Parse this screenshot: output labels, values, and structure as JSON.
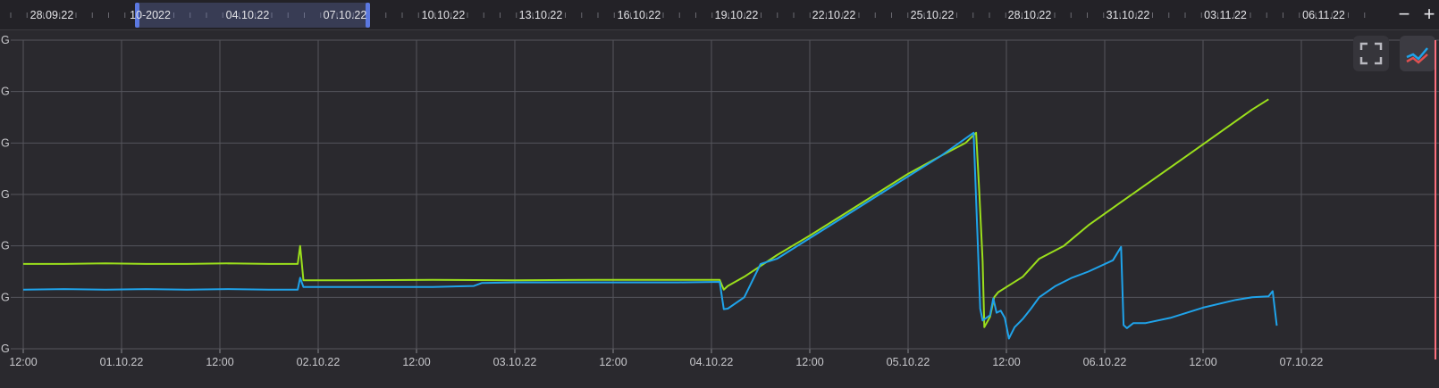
{
  "navigator": {
    "labels": [
      "28.09.22",
      "10-2022",
      "04.10.22",
      "07.10.22",
      "10.10.22",
      "13.10.22",
      "16.10.22",
      "19.10.22",
      "22.10.22",
      "25.10.22",
      "28.10.22",
      "31.10.22",
      "03.11.22",
      "06.11.22"
    ],
    "zoom_out": "−",
    "zoom_in": "+"
  },
  "colors": {
    "background": "#2a292e",
    "grid": "#55555c",
    "series_green": "#9bdf1c",
    "series_blue": "#1fa3ea",
    "marker": "#ff6f7d",
    "selection": "#5b78e0"
  },
  "icons": {
    "fullscreen": "fullscreen-icon",
    "series_toggle": "line-chart-icon"
  },
  "chart_data": {
    "type": "line",
    "x_axis": {
      "tick_labels": [
        "12:00",
        "01.10.22",
        "12:00",
        "02.10.22",
        "12:00",
        "03.10.22",
        "12:00",
        "04.10.22",
        "12:00",
        "05.10.22",
        "12:00",
        "06.10.22",
        "12:00",
        "07.10.22"
      ],
      "range_hours": [
        0,
        168
      ]
    },
    "y_axis": {
      "tick_labels": [
        "G",
        "G",
        "G",
        "G",
        "G",
        "G",
        "G"
      ],
      "range": [
        0,
        6
      ]
    },
    "grid": true,
    "series": [
      {
        "color": "#9bdf1c",
        "points": [
          [
            0,
            1.65
          ],
          [
            5,
            1.65
          ],
          [
            10,
            1.66
          ],
          [
            15,
            1.65
          ],
          [
            20,
            1.65
          ],
          [
            25,
            1.66
          ],
          [
            30,
            1.65
          ],
          [
            33.5,
            1.65
          ],
          [
            33.8,
            2.0
          ],
          [
            34.2,
            1.33
          ],
          [
            40,
            1.33
          ],
          [
            50,
            1.34
          ],
          [
            60,
            1.33
          ],
          [
            70,
            1.34
          ],
          [
            80,
            1.34
          ],
          [
            85,
            1.34
          ],
          [
            85.5,
            1.15
          ],
          [
            86,
            1.22
          ],
          [
            88,
            1.4
          ],
          [
            92,
            1.82
          ],
          [
            96,
            2.2
          ],
          [
            100,
            2.6
          ],
          [
            104,
            3.0
          ],
          [
            108,
            3.4
          ],
          [
            112,
            3.75
          ],
          [
            115,
            4.0
          ],
          [
            116.3,
            4.2
          ],
          [
            116.7,
            3.0
          ],
          [
            117.1,
            1.7
          ],
          [
            117.3,
            0.42
          ],
          [
            118,
            0.62
          ],
          [
            118.5,
            1.0
          ],
          [
            119,
            1.1
          ],
          [
            120,
            1.2
          ],
          [
            122,
            1.4
          ],
          [
            124,
            1.75
          ],
          [
            127,
            2.0
          ],
          [
            130,
            2.4
          ],
          [
            134,
            2.85
          ],
          [
            138,
            3.3
          ],
          [
            142,
            3.75
          ],
          [
            146,
            4.2
          ],
          [
            150,
            4.65
          ],
          [
            152,
            4.85
          ]
        ]
      },
      {
        "color": "#1fa3ea",
        "points": [
          [
            0,
            1.15
          ],
          [
            5,
            1.16
          ],
          [
            10,
            1.15
          ],
          [
            15,
            1.16
          ],
          [
            20,
            1.15
          ],
          [
            25,
            1.16
          ],
          [
            30,
            1.15
          ],
          [
            33.5,
            1.15
          ],
          [
            33.8,
            1.38
          ],
          [
            34.2,
            1.2
          ],
          [
            40,
            1.2
          ],
          [
            50,
            1.2
          ],
          [
            55,
            1.22
          ],
          [
            56,
            1.28
          ],
          [
            60,
            1.29
          ],
          [
            70,
            1.29
          ],
          [
            80,
            1.29
          ],
          [
            85,
            1.3
          ],
          [
            85.5,
            0.77
          ],
          [
            86,
            0.78
          ],
          [
            88,
            1.0
          ],
          [
            90,
            1.65
          ],
          [
            92,
            1.75
          ],
          [
            96,
            2.15
          ],
          [
            100,
            2.55
          ],
          [
            104,
            2.95
          ],
          [
            108,
            3.35
          ],
          [
            112,
            3.75
          ],
          [
            116,
            4.2
          ],
          [
            116.8,
            0.78
          ],
          [
            117.1,
            0.55
          ],
          [
            118,
            0.65
          ],
          [
            118.4,
            0.98
          ],
          [
            118.8,
            0.7
          ],
          [
            119.3,
            0.74
          ],
          [
            119.8,
            0.6
          ],
          [
            120.3,
            0.2
          ],
          [
            121,
            0.42
          ],
          [
            122,
            0.58
          ],
          [
            123,
            0.78
          ],
          [
            124,
            1.0
          ],
          [
            126,
            1.22
          ],
          [
            128,
            1.38
          ],
          [
            130,
            1.5
          ],
          [
            133,
            1.72
          ],
          [
            134,
            1.98
          ],
          [
            134.3,
            0.46
          ],
          [
            134.7,
            0.4
          ],
          [
            135.5,
            0.5
          ],
          [
            137,
            0.5
          ],
          [
            140,
            0.6
          ],
          [
            144,
            0.8
          ],
          [
            148,
            0.95
          ],
          [
            150,
            1.0
          ],
          [
            152,
            1.02
          ],
          [
            152.5,
            1.12
          ],
          [
            153,
            0.45
          ]
        ]
      }
    ]
  }
}
